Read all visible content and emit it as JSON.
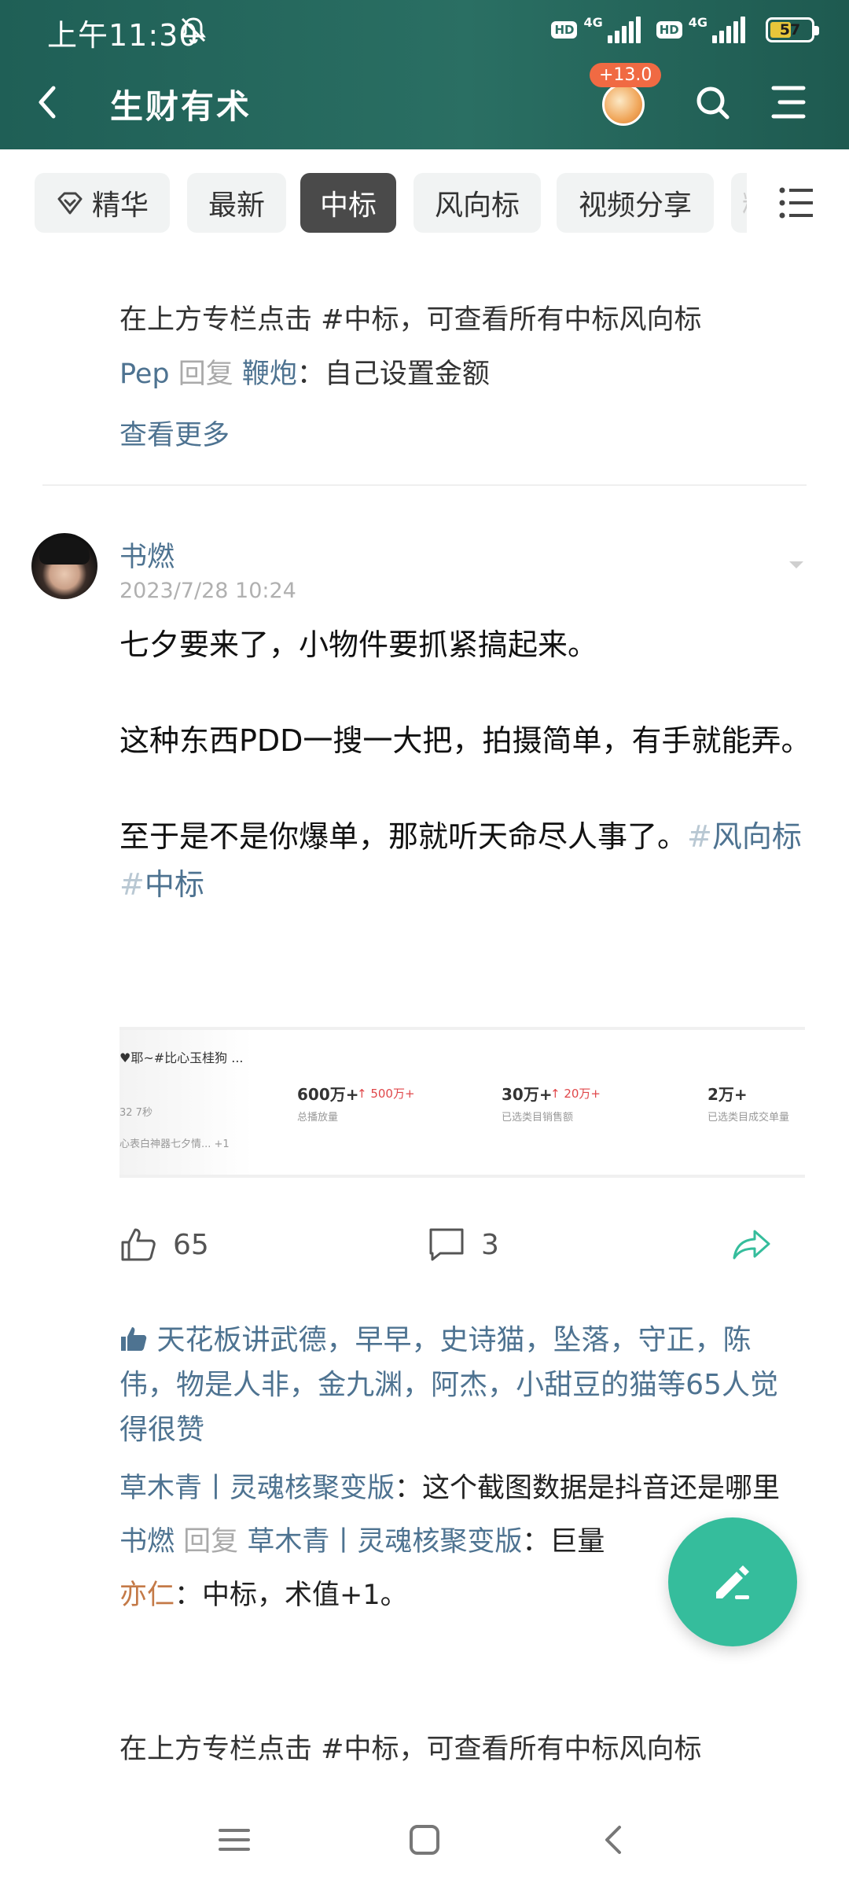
{
  "status_bar": {
    "time": "上午11:30",
    "net1": "4G",
    "net2": "4G",
    "hd": "HD",
    "battery": "57"
  },
  "nav": {
    "title": "生财有术",
    "coin_badge": "+13.0"
  },
  "tabs": [
    {
      "label": "精华",
      "icon": "diamond-icon"
    },
    {
      "label": "最新"
    },
    {
      "label": "中标",
      "active": true
    },
    {
      "label": "风向标"
    },
    {
      "label": "视频分享"
    },
    {
      "label": "精"
    }
  ],
  "prev_post": {
    "pinned_note": "在上方专栏点击 #中标，可查看所有中标风向标",
    "reply": {
      "user": "Pep",
      "reply_word": "回复",
      "target": "鞭炮",
      "text": "：自己设置金额"
    },
    "see_more": "查看更多"
  },
  "post": {
    "author": "书燃",
    "time": "2023/7/28 10:24",
    "paragraph1": "七夕要来了，小物件要抓紧搞起来。",
    "paragraph2": "这种东西PDD一搜一大把，拍摄简单，有手就能弄。",
    "paragraph3": "至于是不是你爆单，那就听天命尽人事了。",
    "hash_symbol": "#",
    "tag1": "风向标",
    "tag2": "中标",
    "image": {
      "title": "♥耶~#比心玉桂狗 ...",
      "sub1": "32  7秒",
      "sub2": "心表白神器七夕情...  +1",
      "stat1_value": "600万+",
      "stat1_delta": "↑ 500万+",
      "stat1_label": "总播放量",
      "stat2_value": "30万+",
      "stat2_delta": "↑ 20万+",
      "stat2_label": "已选类目销售额",
      "stat3_value": "2万+",
      "stat3_label": "已选类目成交单量"
    },
    "likes": "65",
    "comments": "3"
  },
  "likers": {
    "names": [
      "天花板讲武德",
      "早早",
      "史诗猫",
      "坠落",
      "守正",
      "陈伟",
      "物是人非",
      "金九渊",
      "阿杰",
      "小甜豆的猫"
    ],
    "separator": "，",
    "suffix": "等65人觉得很赞"
  },
  "comment_list": [
    {
      "user": "草木青丨灵魂核聚变版",
      "text": "：这个截图数据是抖音还是哪里"
    },
    {
      "user": "书燃",
      "reply_word": "回复",
      "target": "草木青丨灵魂核聚变版",
      "text": "：巨量"
    },
    {
      "user": "亦仁",
      "text": "：中标，术值+1。"
    }
  ],
  "footer_note": "在上方专栏点击 #中标，可查看所有中标风向标",
  "colors": {
    "header_bg": "#2a6f63",
    "link": "#4e7391",
    "fab": "#35bd9c",
    "active_tab": "#4a4a4a",
    "badge": "#f06a43"
  }
}
